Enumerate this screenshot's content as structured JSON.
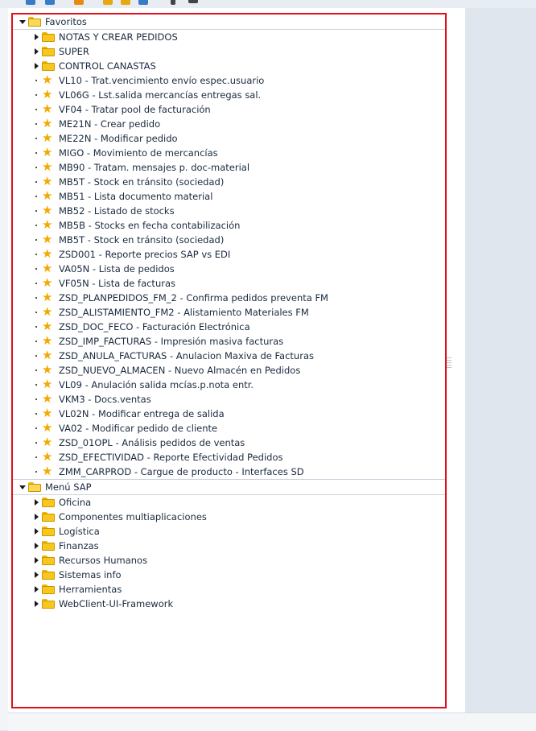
{
  "tree": {
    "favoritos": {
      "label": "Favoritos",
      "folders": [
        "NOTAS Y CREAR PEDIDOS",
        "SUPER",
        "CONTROL CANASTAS"
      ],
      "transactions": [
        "VL10 - Trat.vencimiento envío espec.usuario",
        "VL06G - Lst.salida mercancías entregas sal.",
        "VF04 - Tratar pool de facturación",
        "ME21N - Crear pedido",
        "ME22N - Modificar pedido",
        "MIGO - Movimiento de mercancías",
        "MB90 - Tratam. mensajes p. doc-material",
        "MB5T - Stock en tránsito (sociedad)",
        "MB51 - Lista documento material",
        "MB52 - Listado de stocks",
        "MB5B - Stocks en fecha contabilización",
        "MB5T - Stock en tránsito (sociedad)",
        "ZSD001 - Reporte precios SAP vs EDI",
        "VA05N - Lista de pedidos",
        "VF05N - Lista de facturas",
        "ZSD_PLANPEDIDOS_FM_2 - Confirma pedidos preventa FM",
        "ZSD_ALISTAMIENTO_FM2 - Alistamiento Materiales FM",
        "ZSD_DOC_FECO - Facturación Electrónica",
        "ZSD_IMP_FACTURAS - Impresión masiva facturas",
        "ZSD_ANULA_FACTURAS - Anulacion Maxiva de Facturas",
        "ZSD_NUEVO_ALMACEN - Nuevo Almacén en Pedidos",
        "VL09 - Anulación salida mcías.p.nota entr.",
        "VKM3 - Docs.ventas",
        "VL02N - Modificar entrega de salida",
        "VA02 - Modificar pedido de cliente",
        "ZSD_01OPL - Análisis pedidos de ventas",
        "ZSD_EFECTIVIDAD - Reporte Efectividad Pedidos",
        "ZMM_CARPROD - Cargue de producto - Interfaces SD"
      ]
    },
    "menu_sap": {
      "label": "Menú SAP",
      "folders": [
        "Oficina",
        "Componentes multiaplicaciones",
        "Logística",
        "Finanzas",
        "Recursos Humanos",
        "Sistemas info",
        "Herramientas",
        "WebClient-UI-Framework"
      ]
    }
  },
  "colors": {
    "highlight_border": "#e0101a",
    "favorite_star": "#f2a900",
    "folder": "#f7c71d",
    "text": "#1a2a3e"
  },
  "icons": {
    "favorite": "star-icon",
    "folder": "folder-icon",
    "expanded": "triangle-down-icon",
    "collapsed": "triangle-right-icon"
  }
}
